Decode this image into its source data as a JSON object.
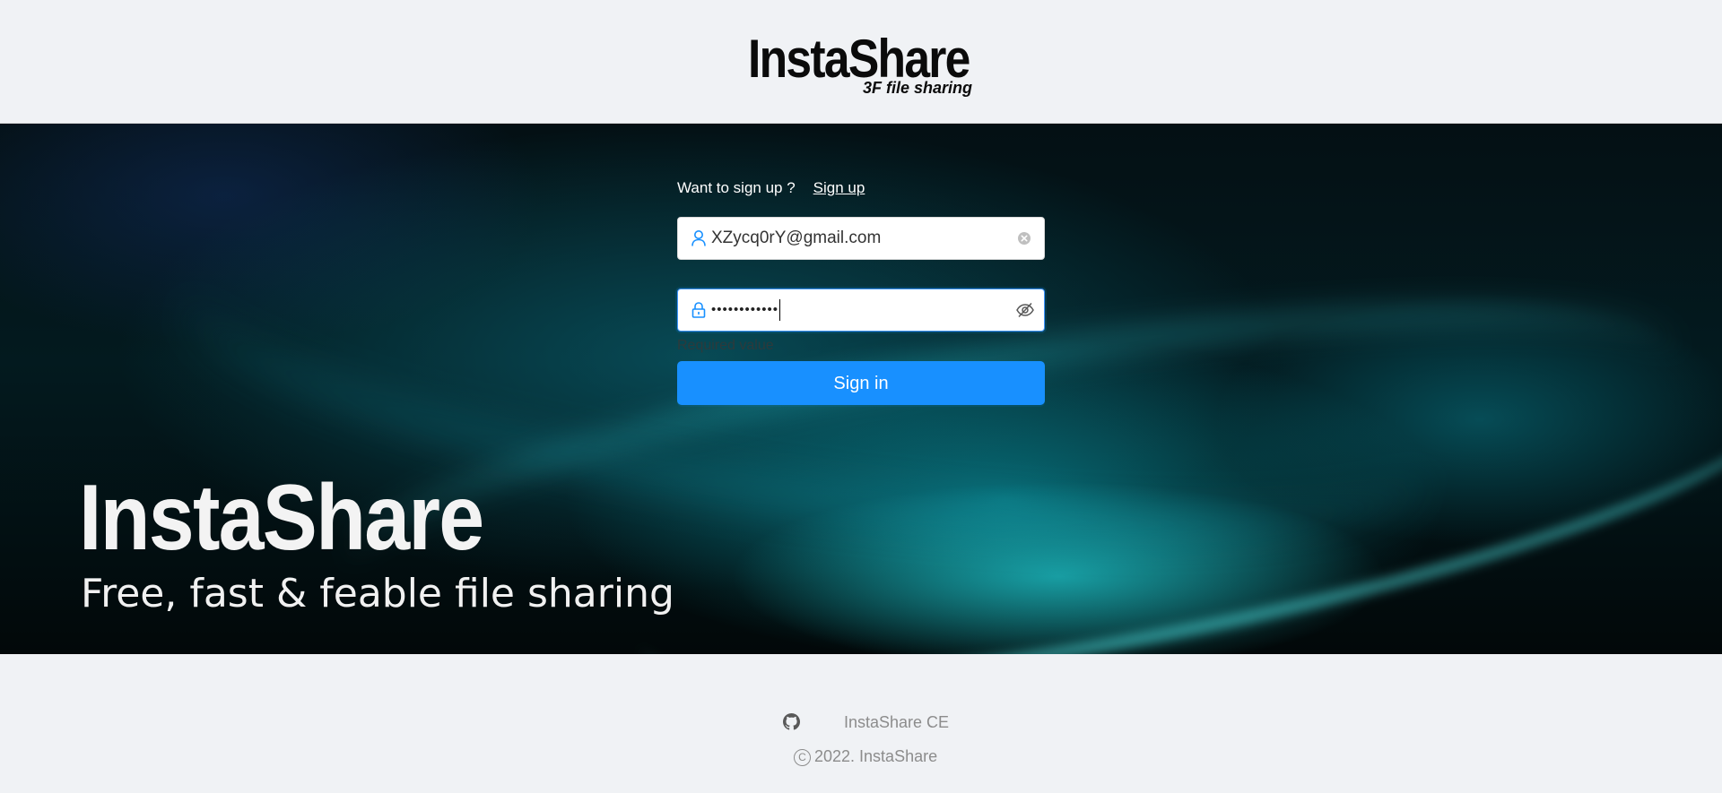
{
  "header": {
    "logo_title": "InstaShare",
    "logo_subtitle": "3F file sharing"
  },
  "hero": {
    "title": "InstaShare",
    "tagline": "Free, fast & feable file sharing"
  },
  "login": {
    "signup_prompt": "Want to sign up ?",
    "signup_link": "Sign up",
    "email_value": "XZycq0rY@gmail.com",
    "password_value": "••••••••••••",
    "password_error": "Required value",
    "signin_label": "Sign in"
  },
  "footer": {
    "project_link": "InstaShare CE",
    "copyright_symbol": "C",
    "copyright_text": "2022. InstaShare"
  },
  "colors": {
    "primary": "#1890ff",
    "page_background": "#f0f2f5",
    "icon_accent": "#1890ff",
    "footer_text": "#8c8c8c"
  },
  "icons": {
    "email_prefix": "user-icon",
    "email_suffix": "clear-icon",
    "password_prefix": "lock-icon",
    "password_suffix": "eye-invisible-icon",
    "footer_link": "github-icon"
  }
}
